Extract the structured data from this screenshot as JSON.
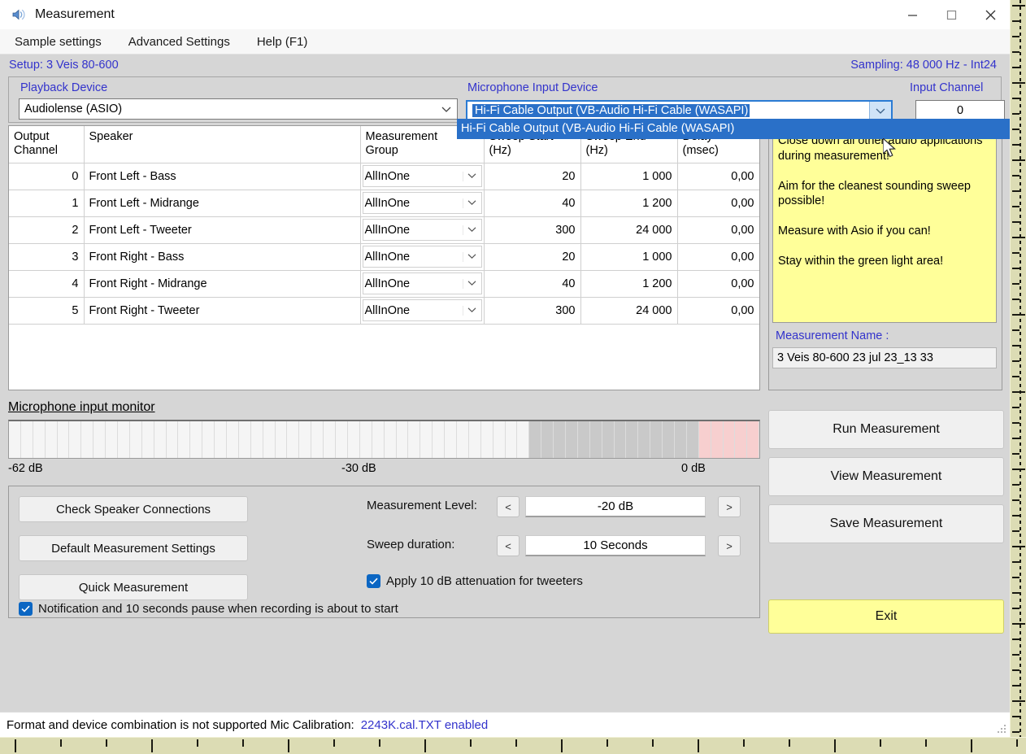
{
  "window": {
    "title": "Measurement",
    "icon": "speaker-icon",
    "minimize": "—",
    "maximize": "☐",
    "close": "✕"
  },
  "menubar": {
    "items": [
      {
        "label": "Sample settings",
        "name": "menu-sample-settings"
      },
      {
        "label": "Advanced Settings",
        "name": "menu-advanced-settings"
      },
      {
        "label": "Help (F1)",
        "name": "menu-help"
      }
    ]
  },
  "setupbar": {
    "setup": "Setup: 3 Veis 80-600",
    "sampling": "Sampling: 48 000 Hz - Int24",
    "accent_color": "#3333cc"
  },
  "devices": {
    "playback_label": "Playback Device",
    "playback_value": "Audiolense (ASIO)",
    "mic_label": "Microphone Input Device",
    "mic_value": "Hi-Fi Cable Output (VB-Audio Hi-Fi Cable (WASAPI)",
    "mic_dropdown_options": [
      "Hi-Fi Cable Output (VB-Audio Hi-Fi Cable (WASAPI)"
    ],
    "input_channel_label": "Input Channel",
    "input_channel_value": "0",
    "selection_color": "#2a70c8"
  },
  "table": {
    "columns": [
      "Output\nChannel",
      "Speaker",
      "Measurement\nGroup",
      "Sweep Start\n(Hz)",
      "Sweep End\n(Hz)",
      "Delay\n(msec)"
    ],
    "rows": [
      {
        "channel": "0",
        "speaker": "Front Left - Bass",
        "group": "AllInOne",
        "sweep_start": "20",
        "sweep_end": "1 000",
        "delay": "0,00",
        "selected": true
      },
      {
        "channel": "1",
        "speaker": "Front Left - Midrange",
        "group": "AllInOne",
        "sweep_start": "40",
        "sweep_end": "1 200",
        "delay": "0,00",
        "selected": false
      },
      {
        "channel": "2",
        "speaker": "Front Left - Tweeter",
        "group": "AllInOne",
        "sweep_start": "300",
        "sweep_end": "24 000",
        "delay": "0,00",
        "selected": false
      },
      {
        "channel": "3",
        "speaker": "Front Right - Bass",
        "group": "AllInOne",
        "sweep_start": "20",
        "sweep_end": "1 000",
        "delay": "0,00",
        "selected": false
      },
      {
        "channel": "4",
        "speaker": "Front Right - Midrange",
        "group": "AllInOne",
        "sweep_start": "40",
        "sweep_end": "1 200",
        "delay": "0,00",
        "selected": false
      },
      {
        "channel": "5",
        "speaker": "Front Right - Tweeter",
        "group": "AllInOne",
        "sweep_start": "300",
        "sweep_end": "24 000",
        "delay": "0,00",
        "selected": false
      }
    ]
  },
  "notes": {
    "text": "Close down all other audio applications during measurement!\n\nAim for the cleanest sounding sweep possible!\n\nMeasure with Asio if you can!\n\nStay within the green light area!",
    "background_color": "#ffff99",
    "measurement_name_label": "Measurement Name :",
    "measurement_name_value": "3 Veis 80-600 23 jul 23_13 33"
  },
  "monitor": {
    "title": "Microphone input monitor",
    "scale_left": "-62 dB",
    "scale_mid": "-30 dB",
    "scale_right": "0 dB",
    "zone_colors": {
      "low": "#f5f5f5",
      "mid": "#c9c9c9",
      "high": "#f7cfcf"
    }
  },
  "controls": {
    "check_speaker_connections": "Check Speaker Connections",
    "default_measurement_settings": "Default Measurement Settings",
    "quick_measurement": "Quick Measurement",
    "measurement_level_label": "Measurement Level:",
    "measurement_level_value": "-20 dB",
    "sweep_duration_label": "Sweep duration:",
    "sweep_duration_value": "10 Seconds",
    "decrement": "<",
    "increment": ">",
    "attenuation_checkbox": "Apply 10 dB attenuation for tweeters",
    "attenuation_checked": true,
    "notification_checkbox": "Notification and 10 seconds pause when recording is about to start",
    "notification_checked": true,
    "checkbox_color": "#0b66c3"
  },
  "actions": {
    "run": "Run Measurement",
    "view": "View Measurement",
    "save": "Save Measurement",
    "exit": "Exit",
    "exit_color": "#ffff99"
  },
  "statusbar": {
    "message": "Format and device combination is not supported  Mic Calibration:",
    "calibration": "2243K.cal.TXT enabled",
    "calibration_color": "#3333cc"
  }
}
